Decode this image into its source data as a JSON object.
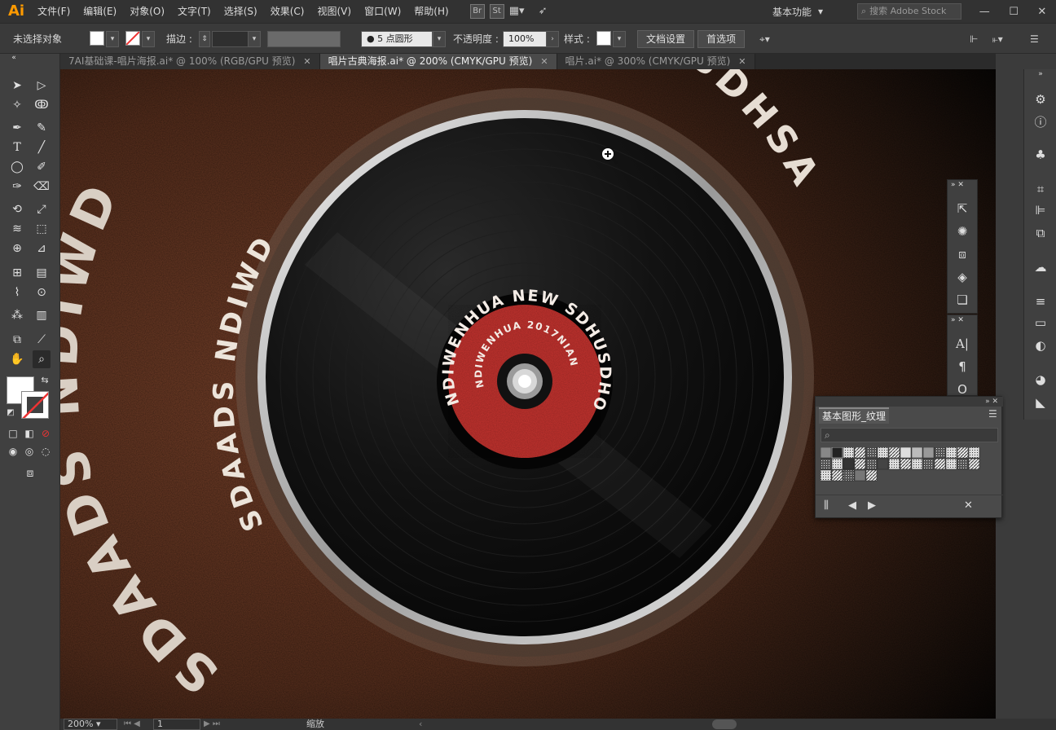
{
  "app": {
    "logo": "Ai"
  },
  "menu": [
    "文件(F)",
    "编辑(E)",
    "对象(O)",
    "文字(T)",
    "选择(S)",
    "效果(C)",
    "视图(V)",
    "窗口(W)",
    "帮助(H)"
  ],
  "menu_icons": {
    "br": "Br",
    "st": "St"
  },
  "workspace": {
    "label": "基本功能",
    "chevron": "▾"
  },
  "stock_search": {
    "placeholder": "搜索 Adobe Stock"
  },
  "control_bar": {
    "selection_label": "未选择对象",
    "stroke_label": "描边 :",
    "brush_value": "5 点圆形",
    "opacity_label": "不透明度 :",
    "opacity_value": "100%",
    "style_label": "样式 :",
    "doc_setup": "文档设置",
    "preferences": "首选项"
  },
  "tabs": [
    {
      "label": "7AI基础课-唱片海报.ai* @ 100% (RGB/GPU 预览)",
      "active": false
    },
    {
      "label": "唱片古典海报.ai* @ 200% (CMYK/GPU 预览)",
      "active": true
    },
    {
      "label": "唱片.ai* @ 300% (CMYK/GPU 预览)",
      "active": false
    }
  ],
  "artwork": {
    "outer_arc_left": "SDAADS NDIWD",
    "outer_arc_top": "ENHUA NEW SDHUSDHSA",
    "inner_arc_left": "SDAADS NDIWD",
    "inner_arc_top": "ENHUA NEW",
    "label_outer_top": "NDIWENHUA NEW SDHUSDHO2",
    "label_inner": "NDIWENHUA 2017NIAN",
    "label_color": "#b8302c",
    "record_color": "#111111",
    "background_color": "#5a3020"
  },
  "swatch_panel": {
    "title": "基本图形_纹理"
  },
  "status_bar": {
    "zoom": "200%",
    "page": "1",
    "tool": "缩放"
  }
}
